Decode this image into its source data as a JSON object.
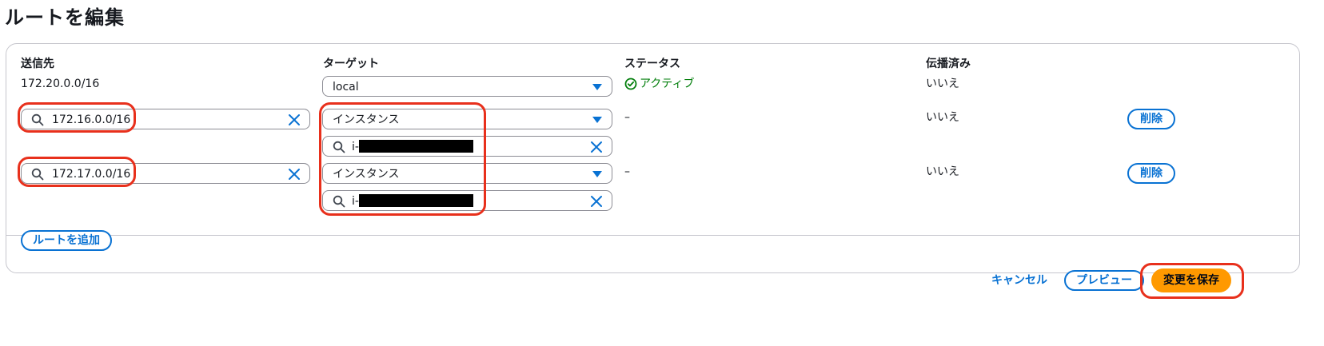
{
  "page": {
    "title": "ルートを編集"
  },
  "table": {
    "headers": {
      "destination": "送信先",
      "target": "ターゲット",
      "status": "ステータス",
      "propagated": "伝播済み"
    },
    "rows": [
      {
        "destination": "172.20.0.0/16",
        "target_type": "local",
        "status": "アクティブ",
        "propagated": "いいえ"
      },
      {
        "destination": "172.16.0.0/16",
        "target_type": "インスタンス",
        "target_instance_prefix": "i-",
        "status": "–",
        "propagated": "いいえ",
        "remove_label": "削除"
      },
      {
        "destination": "172.17.0.0/16",
        "target_type": "インスタンス",
        "target_instance_prefix": "i-",
        "status": "–",
        "propagated": "いいえ",
        "remove_label": "削除"
      }
    ]
  },
  "footer": {
    "add_route_label": "ルートを追加"
  },
  "actions": {
    "cancel_label": "キャンセル",
    "preview_label": "プレビュー",
    "save_label": "変更を保存"
  },
  "colors": {
    "accent": "#0972d3",
    "primary_button": "#ff9900",
    "status_active": "#037f0c",
    "highlight": "#e8301c"
  },
  "icons": {
    "search": "search-icon",
    "clear": "close-icon",
    "caret": "caret-down-icon",
    "status": "check-circle-icon"
  }
}
